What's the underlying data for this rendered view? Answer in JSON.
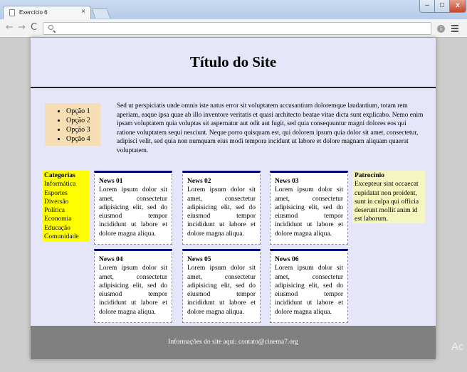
{
  "browser": {
    "tab_title": "Exercício 6",
    "tab_close": "×",
    "address": "",
    "nav": {
      "back": "←",
      "forward": "→",
      "reload": "C"
    },
    "info_icon": "i",
    "window": {
      "minimize": "–",
      "maximize": "□",
      "close": "x"
    }
  },
  "site": {
    "title": "Título do Site",
    "menu": [
      "Opção 1",
      "Opção 2",
      "Opção 3",
      "Opção 4"
    ],
    "intro": "Sed ut perspiciatis unde omnis iste natus error sit voluptatem accusantium doloremque laudantium, totam rem aperiam, eaque ipsa quae ab illo inventore veritatis et quasi architecto beatae vitae dicta sunt explicabo. Nemo enim ipsam voluptatem quia voluptas sit aspernatur aut odit aut fugit, sed quia consequuntur magni dolores eos qui ratione voluptatem sequi nesciunt. Neque porro quisquam est, qui dolorem ipsum quia dolor sit amet, consectetur, adipisci velit, sed quia non numquam eius modi tempora incidunt ut labore et dolore magnam aliquam quaerat voluptatem.",
    "categories": {
      "heading": "Categorias",
      "items": [
        "Informática",
        "Esportes",
        "Diversão",
        "Política",
        "Economia",
        "Educação",
        "Comunidade"
      ]
    },
    "news": [
      {
        "title": "News 01",
        "text": "Lorem ipsum dolor sit amet, consectetur adipisicing elit, sed do eiusmod tempor incididunt ut labore et dolore magna aliqua."
      },
      {
        "title": "News 02",
        "text": "Lorem ipsum dolor sit amet, consectetur adipisicing elit, sed do eiusmod tempor incididunt ut labore et dolore magna aliqua."
      },
      {
        "title": "News 03",
        "text": "Lorem ipsum dolor sit amet, consectetur adipisicing elit, sed do eiusmod tempor incididunt ut labore et dolore magna aliqua."
      },
      {
        "title": "News 04",
        "text": "Lorem ipsum dolor sit amet, consectetur adipisicing elit, sed do eiusmod tempor incididunt ut labore et dolore magna aliqua."
      },
      {
        "title": "News 05",
        "text": "Lorem ipsum dolor sit amet, consectetur adipisicing elit, sed do eiusmod tempor incididunt ut labore et dolore magna aliqua."
      },
      {
        "title": "News 06",
        "text": "Lorem ipsum dolor sit amet, consectetur adipisicing elit, sed do eiusmod tempor incididunt ut labore et dolore magna aliqua."
      }
    ],
    "sponsor": {
      "heading": "Patrocínio",
      "text": "Excepteur sint occaecat cupidatat non proident, sunt in culpa qui officia deserunt mollit anim id est laborum."
    },
    "footer": "Informações do site aqui: contato@cinema7.org"
  },
  "watermark": "Ac",
  "colors": {
    "page_bg": "#e6e6fa",
    "menu_bg": "#f5deb3",
    "categories_bg": "#ffff00",
    "sponsor_bg": "#f5f5c0",
    "news_border_top": "#00007a",
    "footer_bg": "#808080"
  }
}
